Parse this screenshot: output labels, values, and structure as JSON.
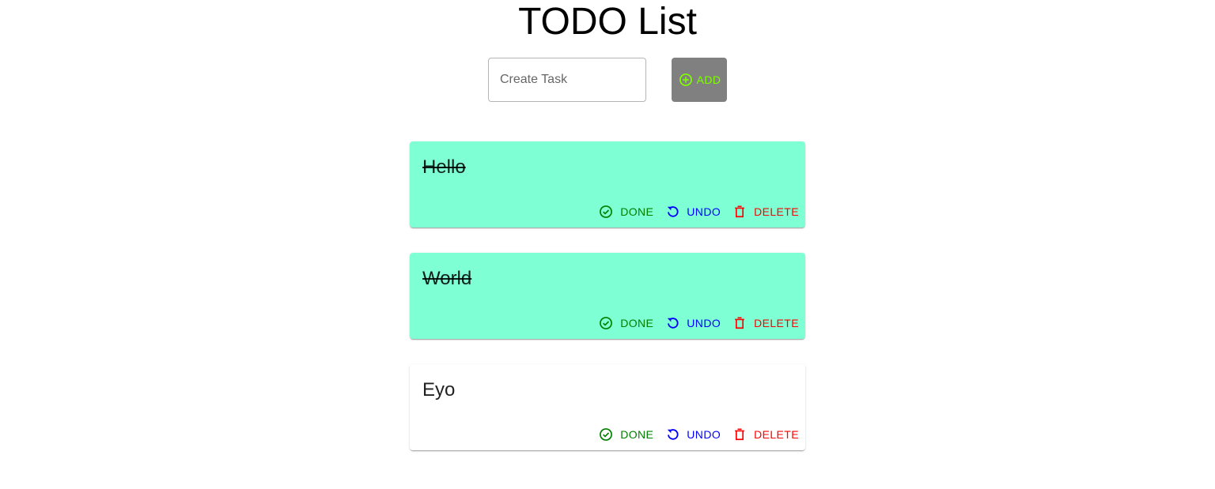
{
  "header": {
    "title": "TODO List"
  },
  "create": {
    "placeholder": "Create Task",
    "value": "",
    "add_label": "Add",
    "add_icon": "add-circle-outline-icon"
  },
  "actions": {
    "done_label": "Done",
    "undo_label": "Undo",
    "delete_label": "Delete",
    "done_icon": "check-circle-outline-icon",
    "undo_icon": "undo-icon",
    "delete_icon": "trash-icon"
  },
  "colors": {
    "completed_bg": "#7fffd4",
    "pending_bg": "#ffffff",
    "add_button_bg": "#808080",
    "add_text": "#7fff00",
    "done": "#008000",
    "undo": "#0000ff",
    "delete": "#ff0000"
  },
  "tasks": [
    {
      "text": "Hello",
      "completed": true
    },
    {
      "text": "World",
      "completed": true
    },
    {
      "text": "Eyo",
      "completed": false
    }
  ]
}
